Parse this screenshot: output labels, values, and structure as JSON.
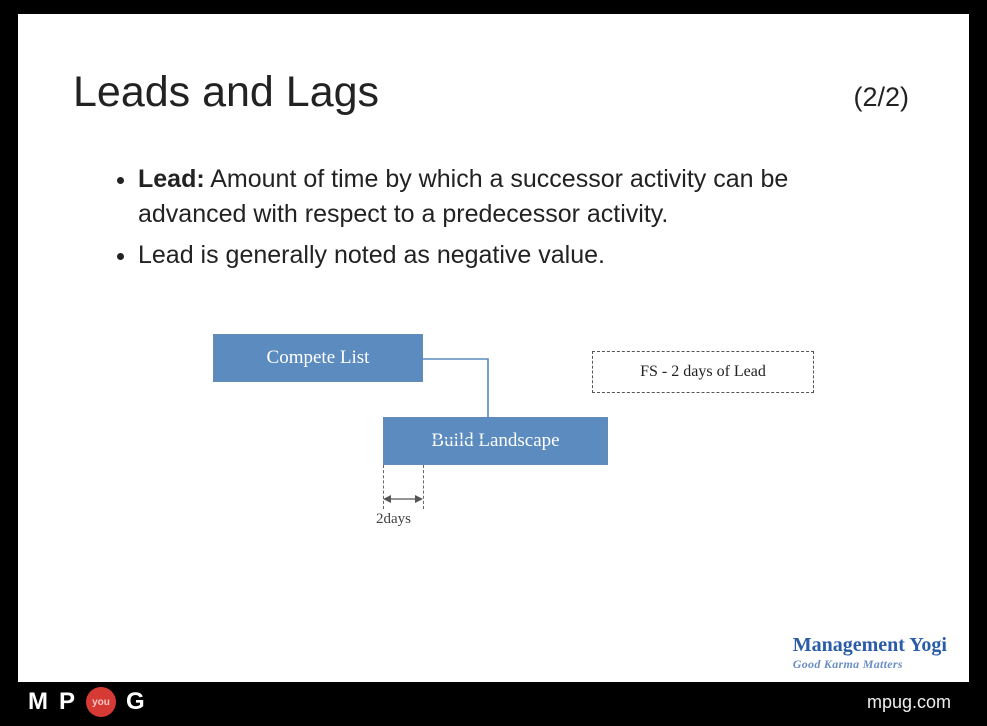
{
  "slide": {
    "title": "Leads and Lags",
    "page": "(2/2)",
    "bullets": [
      {
        "prefix": "Lead:",
        "text": " Amount of time by which a successor activity can be advanced with respect to a predecessor activity."
      },
      {
        "prefix": "",
        "text": "Lead is generally noted as negative value."
      }
    ],
    "diagram": {
      "box_a": "Compete List",
      "box_b": "Build Landscape",
      "note": "FS - 2 days of Lead",
      "measure": "2days"
    },
    "brand": {
      "name": "Management Yogi",
      "tagline": "Good Karma Matters"
    }
  },
  "footer": {
    "logo_m": "M",
    "logo_p": "P",
    "logo_dot": "you",
    "logo_g": "G",
    "site": "mpug.com"
  }
}
